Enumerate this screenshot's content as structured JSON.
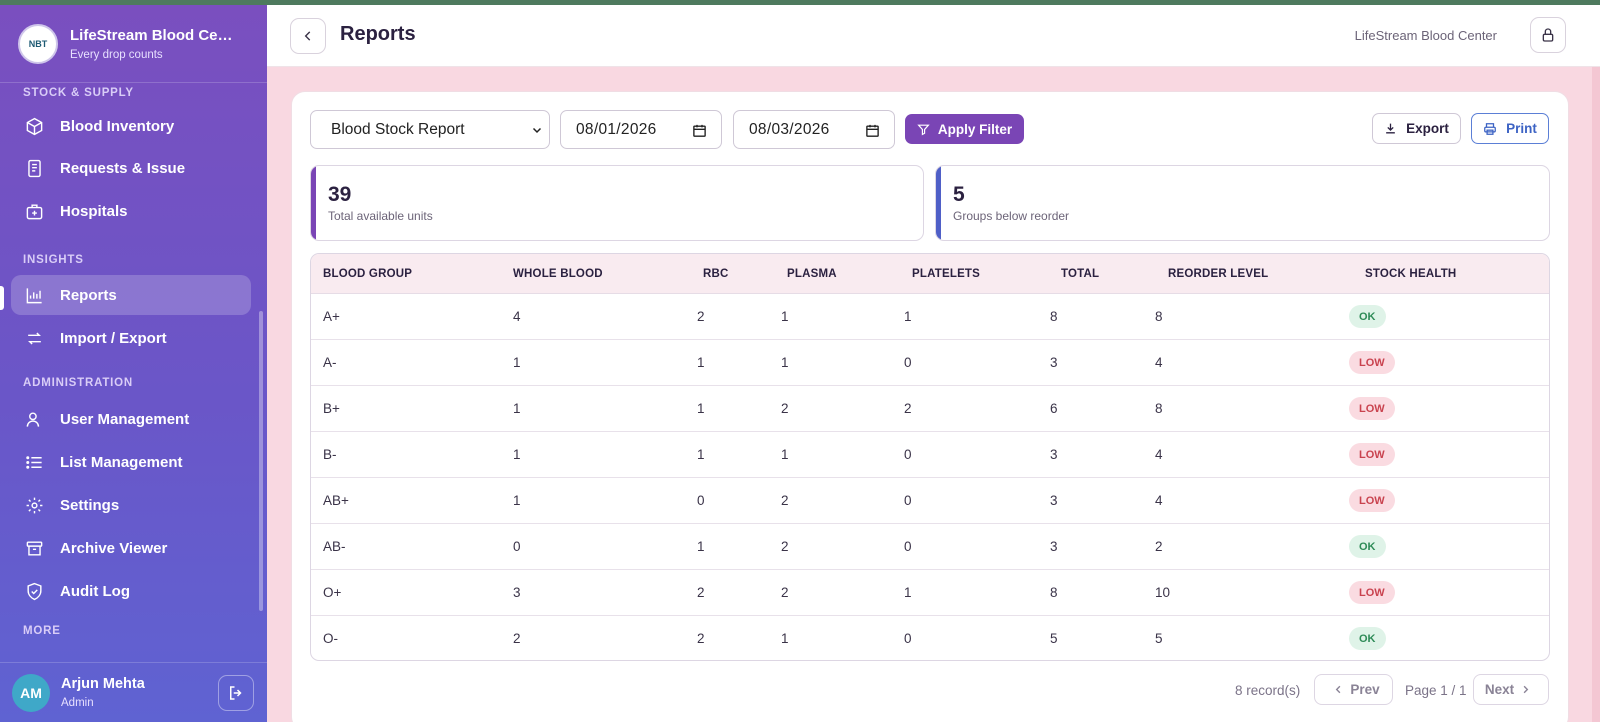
{
  "app": {
    "name": "LifeStream Blood Center",
    "tagline": "Every drop counts",
    "logo_text": "NBT"
  },
  "sidebar": {
    "sections": {
      "stock": "STOCK & SUPPLY",
      "insights": "INSIGHTS",
      "admin": "ADMINISTRATION",
      "more": "MORE"
    },
    "items": [
      {
        "label": "Blood Inventory",
        "icon": "cube-icon"
      },
      {
        "label": "Requests & Issue",
        "icon": "document-icon"
      },
      {
        "label": "Hospitals",
        "icon": "hospital-icon"
      },
      {
        "label": "Reports",
        "icon": "bar-chart-icon",
        "active": true
      },
      {
        "label": "Import / Export",
        "icon": "arrows-swap-icon"
      },
      {
        "label": "User Management",
        "icon": "user-icon"
      },
      {
        "label": "List Management",
        "icon": "list-icon"
      },
      {
        "label": "Settings",
        "icon": "gear-icon"
      },
      {
        "label": "Archive Viewer",
        "icon": "archive-icon"
      },
      {
        "label": "Audit Log",
        "icon": "shield-check-icon"
      }
    ],
    "user": {
      "initials": "AM",
      "name": "Arjun Mehta",
      "role": "Admin"
    }
  },
  "header": {
    "title": "Reports",
    "org": "LifeStream Blood Center"
  },
  "filters": {
    "report_type": "Blood Stock Report",
    "from_date": "08/01/2026",
    "to_date": "08/03/2026",
    "apply_label": "Apply Filter",
    "export_label": "Export",
    "print_label": "Print"
  },
  "stats": [
    {
      "value": "39",
      "label": "Total available units",
      "accent": "#7a45b5"
    },
    {
      "value": "5",
      "label": "Groups below reorder",
      "accent": "#4f5fc7"
    }
  ],
  "table": {
    "columns": [
      "BLOOD GROUP",
      "WHOLE BLOOD",
      "RBC",
      "PLASMA",
      "PLATELETS",
      "TOTAL",
      "REORDER LEVEL",
      "STOCK HEALTH"
    ],
    "rows": [
      [
        "A+",
        "4",
        "2",
        "1",
        "1",
        "8",
        "8",
        "OK"
      ],
      [
        "A-",
        "1",
        "1",
        "1",
        "0",
        "3",
        "4",
        "LOW"
      ],
      [
        "B+",
        "1",
        "1",
        "2",
        "2",
        "6",
        "8",
        "LOW"
      ],
      [
        "B-",
        "1",
        "1",
        "1",
        "0",
        "3",
        "4",
        "LOW"
      ],
      [
        "AB+",
        "1",
        "0",
        "2",
        "0",
        "3",
        "4",
        "LOW"
      ],
      [
        "AB-",
        "0",
        "1",
        "2",
        "0",
        "3",
        "2",
        "OK"
      ],
      [
        "O+",
        "3",
        "2",
        "2",
        "1",
        "8",
        "10",
        "LOW"
      ],
      [
        "O-",
        "2",
        "2",
        "1",
        "0",
        "5",
        "5",
        "OK"
      ]
    ]
  },
  "pagination": {
    "records": "8 record(s)",
    "prev": "Prev",
    "page": "Page 1 / 1",
    "next": "Next"
  },
  "colors": {
    "ok_badge": "#2e8b57",
    "low_badge": "#c9434f",
    "brand_purple": "#7a45b5"
  }
}
